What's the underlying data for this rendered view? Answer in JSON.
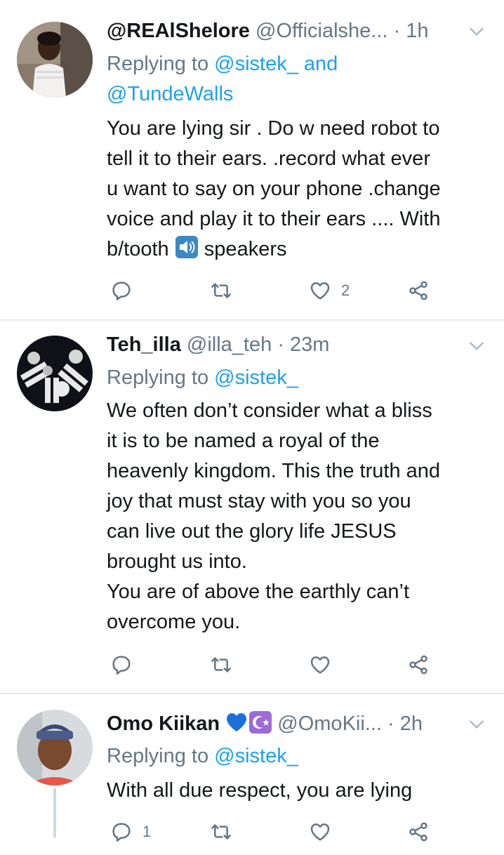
{
  "tweets": [
    {
      "name": "@REAlShelore",
      "handle": "@Officialshe...",
      "dot": "·",
      "time": "1h",
      "replying_prefix": "Replying to ",
      "mentions_line1": "@sistek_ and",
      "mentions_line2": "@TundeWalls",
      "body_1": "You are lying sir . Do w need robot to\ntell it to their ears. .record what ever\nu want to say on your phone .change\nvoice and play it to their ears .... With\nb/tooth ",
      "body_2": " speakers",
      "reply_count": "",
      "retweet_count": "",
      "like_count": "2"
    },
    {
      "name": "Teh_illa",
      "handle": "@illa_teh",
      "dot": "·",
      "time": "23m",
      "replying_prefix": "Replying to ",
      "mentions_line1": "@sistek_",
      "body": "We often don’t consider what a bliss\nit is to be named a royal of the\nheavenly kingdom. This the truth and\njoy that must stay with you so you\ncan live out the glory life JESUS\nbrought us into.\nYou are of above the earthly can’t\novercome you.",
      "reply_count": "",
      "retweet_count": "",
      "like_count": ""
    },
    {
      "name": "Omo Kiikan",
      "handle": "@OmoKii...",
      "dot": "·",
      "time": "2h",
      "replying_prefix": "Replying to ",
      "mentions_line1": "@sistek_",
      "body": "With all due respect, you are lying",
      "reply_count": "1",
      "retweet_count": "",
      "like_count": ""
    }
  ],
  "colors": {
    "link": "#1da1f2",
    "muted": "#657786",
    "text": "#14171a",
    "divider": "#e6ecf0"
  },
  "icons": [
    "reply-icon",
    "retweet-icon",
    "like-icon",
    "share-icon",
    "chevron-down-icon",
    "speaker-emoji-icon",
    "blue-heart-emoji-icon",
    "star-crescent-emoji-icon"
  ]
}
